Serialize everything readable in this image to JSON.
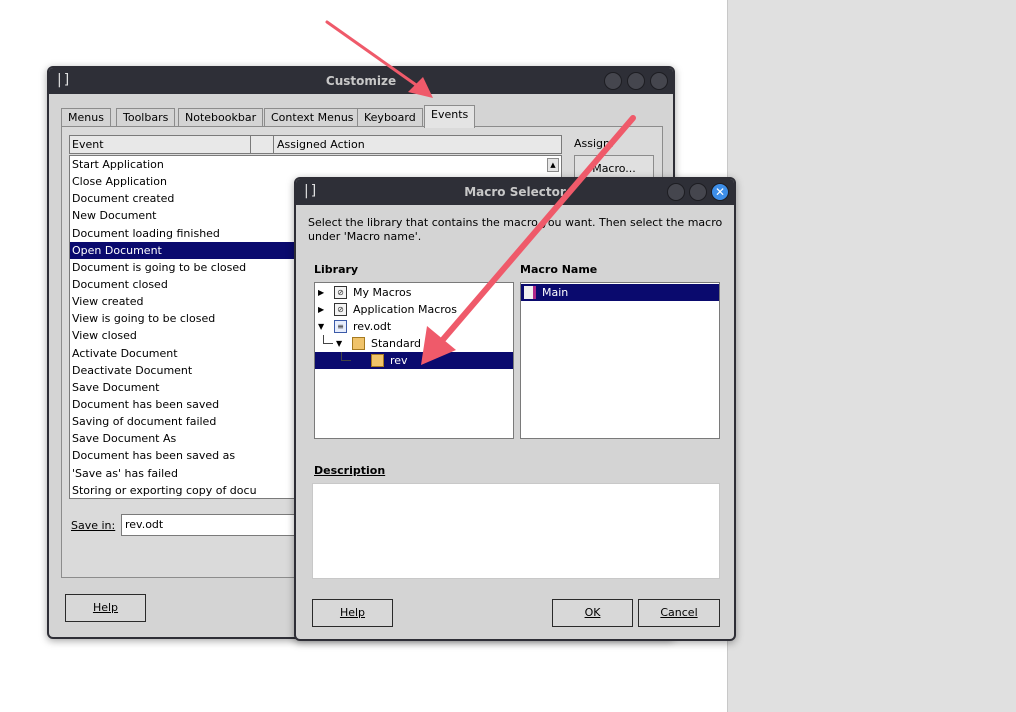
{
  "customize": {
    "title": "Customize",
    "app_glyph": "|]",
    "tabs": [
      "Menus",
      "Toolbars",
      "Notebookbar",
      "Context Menus",
      "Keyboard",
      "Events"
    ],
    "active_tab": "Events",
    "columns": {
      "event": "Event",
      "assigned_action": "Assigned Action"
    },
    "events": [
      "Start Application",
      "Close Application",
      "Document created",
      "New Document",
      "Document loading finished",
      "Open Document",
      "Document is going to be closed",
      "Document closed",
      "View created",
      "View is going to be closed",
      "View closed",
      "Activate Document",
      "Deactivate Document",
      "Save Document",
      "Document has been saved",
      "Saving of document failed",
      "Save Document As",
      "Document has been saved as",
      "'Save as' has failed",
      "Storing or exporting copy of docu"
    ],
    "selected_event": "Open Document",
    "assign_label": "Assign:",
    "macro_button": "Macro...",
    "save_in_label": "Save in:",
    "save_in_value": "rev.odt",
    "help_button": "Help"
  },
  "selector": {
    "title": "Macro Selector",
    "app_glyph": "|]",
    "close_glyph": "✕",
    "instructions": "Select the library that contains the macro you want. Then select the macro under 'Macro name'.",
    "library_label": "Library",
    "macro_name_label": "Macro Name",
    "library_tree": [
      {
        "label": "My Macros",
        "expanded": false
      },
      {
        "label": "Application Macros",
        "expanded": false
      },
      {
        "label": "rev.odt",
        "expanded": true
      },
      {
        "label": "Standard",
        "expanded": true
      },
      {
        "label": "rev",
        "selected": true
      }
    ],
    "macros": [
      "Main"
    ],
    "description_label": "Description",
    "description": "",
    "help_button": "Help",
    "ok_button": "OK",
    "cancel_button": "Cancel"
  },
  "colors": {
    "selection": "#0a0a6e",
    "titlebar": "#2e2f37",
    "annotation_arrow": "#ef5a6a",
    "close_button": "#3d8ee8"
  }
}
